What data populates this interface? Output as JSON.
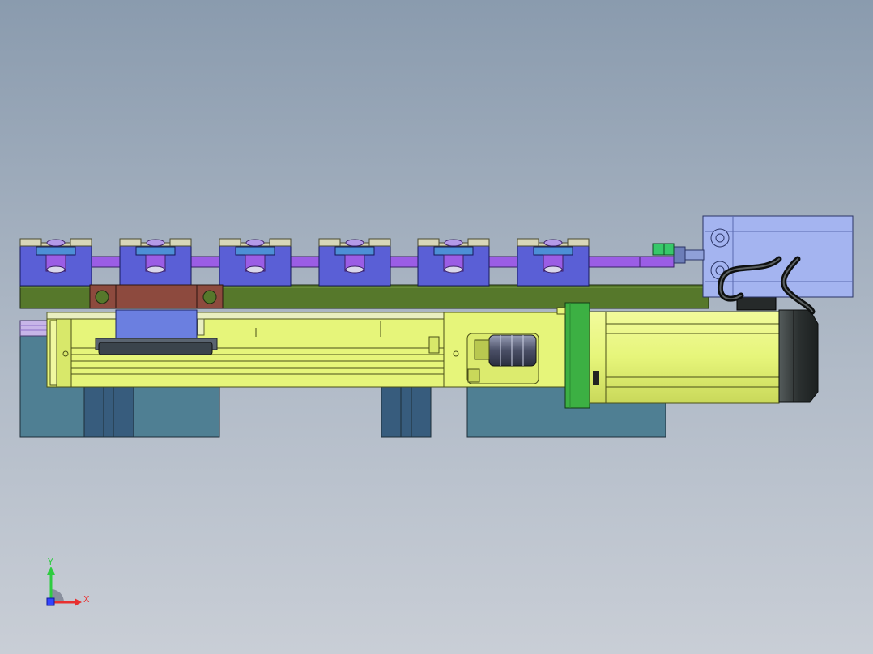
{
  "viewport": {
    "background_top": "#8a9bae",
    "background_bottom": "#c9ced6"
  },
  "colors": {
    "clamp_block": "#5a5fd6",
    "clamp_pad": "#d8d6b8",
    "bar": "#9b5de5",
    "base_plate": "#56782b",
    "bracket": "#8d4a3e",
    "carriage": "#6b7fe0",
    "actuator": "#e6f57a",
    "pedestal": "#4f7f93",
    "pedestal_dark": "#375c7d",
    "motor_flange": "#3cb043",
    "motor_endcap": "#333a3a",
    "cylinder": "#a4b4f0",
    "sensor": "#37c86a"
  },
  "triad": {
    "x_label": "X",
    "y_label": "Y",
    "x_color": "#e83030",
    "y_color": "#2ecc40",
    "z_color": "#3344ff"
  }
}
